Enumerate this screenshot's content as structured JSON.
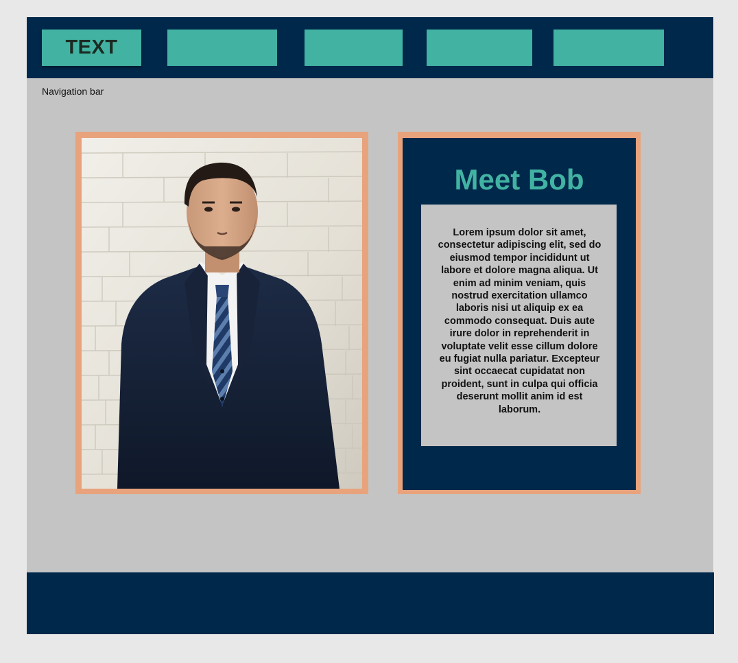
{
  "navbar": {
    "buttons": [
      {
        "label": "TEXT"
      },
      {
        "label": ""
      },
      {
        "label": ""
      },
      {
        "label": ""
      },
      {
        "label": ""
      }
    ],
    "caption": "Navigation bar"
  },
  "profile": {
    "photo_subject": "man in dark suit and striped tie against white brick wall",
    "title": "Meet Bob",
    "bio": "Lorem ipsum dolor sit amet, consectetur adipiscing elit, sed do eiusmod tempor incididunt ut labore et dolore magna aliqua. Ut enim ad minim veniam, quis nostrud exercitation ullamco laboris nisi ut aliquip ex ea commodo consequat. Duis aute irure dolor in reprehenderit in voluptate velit esse cillum dolore eu fugiat nulla pariatur. Excepteur sint occaecat cupidatat non proident, sunt in culpa qui officia deserunt mollit anim id est laborum."
  },
  "colors": {
    "navy": "#00284b",
    "teal": "#42b3a3",
    "frame": "#e8a37c",
    "page_gray": "#c4c4c4"
  }
}
